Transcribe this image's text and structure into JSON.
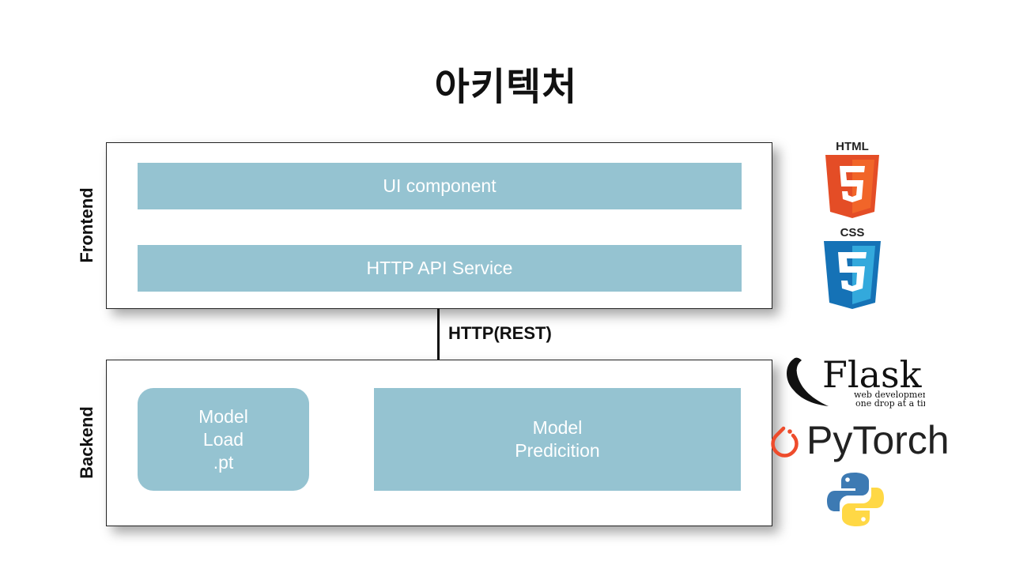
{
  "title": "아키텍처",
  "frontend": {
    "label": "Frontend",
    "items": [
      "UI component",
      "HTTP API Service"
    ]
  },
  "connector": {
    "label": "HTTP(REST)"
  },
  "backend": {
    "label": "Backend",
    "model_load": [
      "Model",
      "Load",
      ".pt"
    ],
    "model_prediction": [
      "Model",
      "Predicition"
    ]
  },
  "logos": {
    "html": "HTML",
    "css": "CSS",
    "flask": {
      "name": "Flask",
      "tagline_1": "web development,",
      "tagline_2": "one drop at a time"
    },
    "pytorch": "PyTorch",
    "python": "python-icon"
  },
  "colors": {
    "box": "#95c3d1",
    "html": "#e44d26",
    "css": "#1572b6",
    "pytorch": "#ee4c2c"
  }
}
